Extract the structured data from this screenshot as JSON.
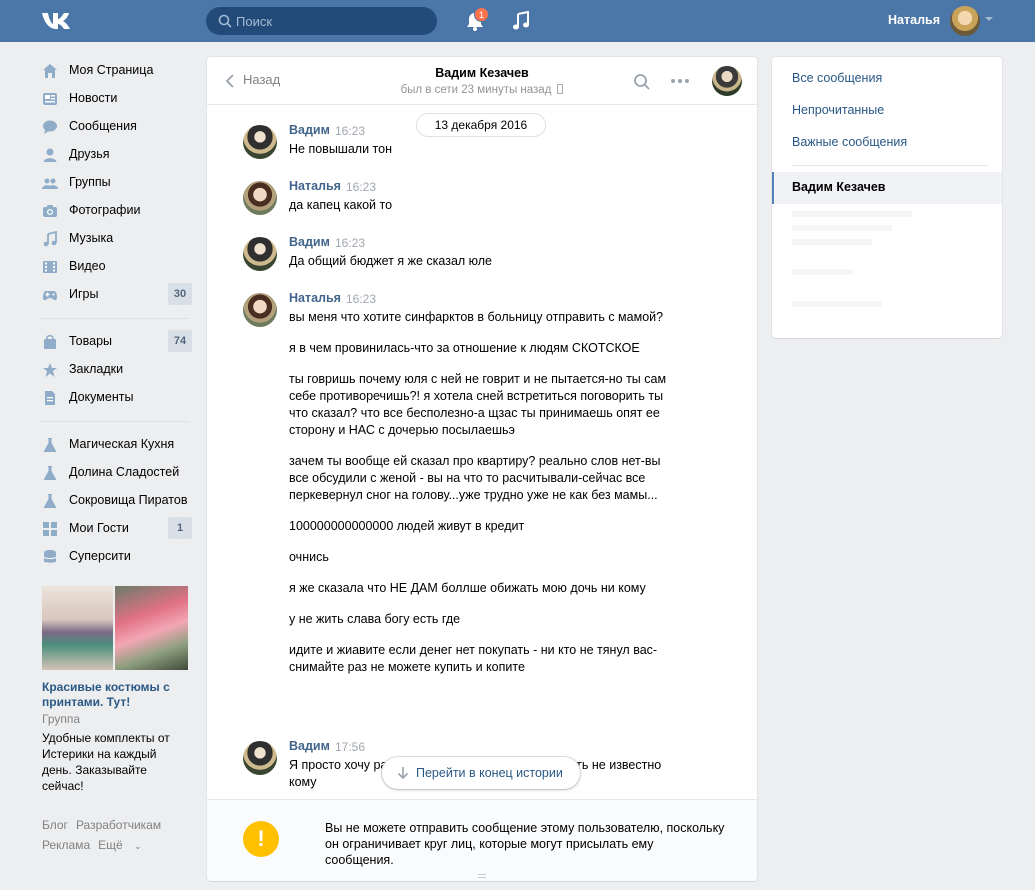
{
  "colors": {
    "header": "#4a76a8",
    "link": "#2a5885",
    "author": "#42648b",
    "warning": "#ffc000",
    "badge": "#ff734c"
  },
  "header": {
    "logo_icon": "vk-logo-icon",
    "search_placeholder": "Поиск",
    "notifications_count": "1",
    "user_name": "Наталья"
  },
  "nav": {
    "items": [
      {
        "label": "Моя Страница",
        "icon": "home-icon"
      },
      {
        "label": "Новости",
        "icon": "news-icon"
      },
      {
        "label": "Сообщения",
        "icon": "messages-icon"
      },
      {
        "label": "Друзья",
        "icon": "friends-icon"
      },
      {
        "label": "Группы",
        "icon": "groups-icon"
      },
      {
        "label": "Фотографии",
        "icon": "camera-icon"
      },
      {
        "label": "Музыка",
        "icon": "music-icon"
      },
      {
        "label": "Видео",
        "icon": "video-icon"
      },
      {
        "label": "Игры",
        "icon": "gamepad-icon",
        "count": "30"
      },
      {
        "label": "Товары",
        "icon": "bag-icon",
        "count": "74"
      },
      {
        "label": "Закладки",
        "icon": "star-icon"
      },
      {
        "label": "Документы",
        "icon": "document-icon"
      },
      {
        "label": "Магическая Кухня",
        "icon": "flask-icon"
      },
      {
        "label": "Долина Сладостей",
        "icon": "flask-icon"
      },
      {
        "label": "Сокровища Пиратов",
        "icon": "flask-icon"
      },
      {
        "label": "Мои Гости",
        "icon": "grid-icon",
        "count": "1"
      },
      {
        "label": "Суперсити",
        "icon": "database-icon"
      }
    ]
  },
  "promo": {
    "title": "Красивые костюмы с принтами. Тут!",
    "type": "Группа",
    "description": "Удобные комплекты от Истерики на каждый день. Заказывайте сейчас!"
  },
  "footer": {
    "blog": "Блог",
    "developers": "Разработчикам",
    "ads": "Реклама",
    "more": "Ещё"
  },
  "chat": {
    "back_label": "Назад",
    "peer_name": "Вадим Кезачев",
    "peer_status": "был в сети 23 минуты назад",
    "date_label": "13 декабря 2016",
    "messages": [
      {
        "author": "Вадим",
        "time": "16:23",
        "paragraphs": [
          "Не повышали тон"
        ]
      },
      {
        "author": "Наталья",
        "time": "16:23",
        "paragraphs": [
          "да капец какой то"
        ]
      },
      {
        "author": "Вадим",
        "time": "16:23",
        "paragraphs": [
          "Да общий бюджет я же сказал юле"
        ]
      },
      {
        "author": "Наталья",
        "time": "16:23",
        "paragraphs": [
          "вы меня что хотите синфарктов в больницу отправить с мамой?",
          "я в чем провинилась-что за отношение к людям СКОТСКОЕ",
          "ты говришь почему юля с ней не говрит и не пытается-но ты сам себе противоречишь?! я хотела сней встретиться поговорить ты что сказал? что все бесполезно-а щзас ты принимаешь опят ее сторону и НАС с дочерью посылаешьэ",
          "зачем ты вообще ей сказал про квартиру? реально слов нет-вы все обсудили с женой - вы на что то расчитывали-сейчас все перкевернул сног на голову...уже трудно уже не как без мамы...",
          "100000000000000 людей живут в кредит",
          "очнись",
          "я же сказала что НЕ ДАМ боллше обижать мою дочь ни кому",
          "у не жить слава богу есть где",
          "идите и жиавите если денег нет покупать - ни кто не тянул вас-снимайте раз не можете купить и копите"
        ]
      },
      {
        "author": "Вадим",
        "time": "17:56",
        "paragraphs": [
          "Я просто хочу разобраться зачем мне выплачивать не известно кому"
        ]
      }
    ],
    "jump_label": "Перейти в конец истории",
    "blocked_notice": "Вы не можете отправить сообщение этому пользователю, поскольку он ограничивает круг лиц, которые могут присылать ему сообщения."
  },
  "right_panel": {
    "all_messages": "Все сообщения",
    "unread": "Непрочитанные",
    "important": "Важные сообщения",
    "active_dialog": "Вадим Кезачев"
  }
}
